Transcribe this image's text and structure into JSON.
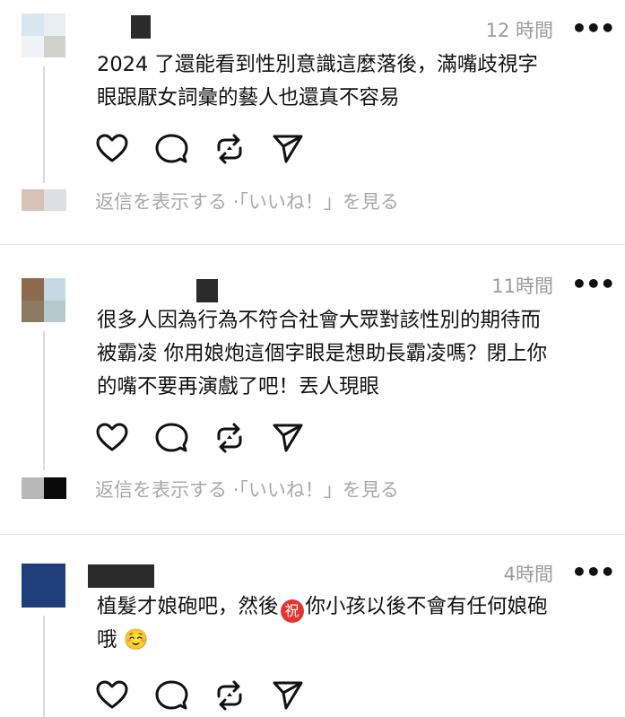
{
  "posts": [
    {
      "time": "12 時間",
      "text": "2024 了還能看到性別意識這麼落後，滿嘴歧視字\n眼跟厭女詞彙的藝人也還真不容易",
      "reply_text": "返信を表示する ·「いいね！」を見る"
    },
    {
      "time": "11時間",
      "text": "很多人因為行為不符合社會大眾對該性別的期待而\n被霸凌 你用娘炮這個字眼是想助長霸凌嗎？閉上你\n的嘴不要再演戲了吧！丟人現眼",
      "reply_text": "返信を表示する ·「いいね！」を見る"
    },
    {
      "time": "4時間",
      "text_before": "植髮才娘砲吧，然後",
      "badge": "祝",
      "text_after": "你小孩以後不會有任何娘砲\n哦 ☺️"
    }
  ],
  "icons": {
    "like": "heart-icon",
    "comment": "comment-icon",
    "repost": "repost-icon",
    "share": "send-icon",
    "more": "more-dots-icon"
  },
  "colors": {
    "muted_text": "#9b9b9b",
    "divider": "#e5e5e5",
    "thread_line": "#dadada",
    "badge_red": "#e5332f"
  }
}
